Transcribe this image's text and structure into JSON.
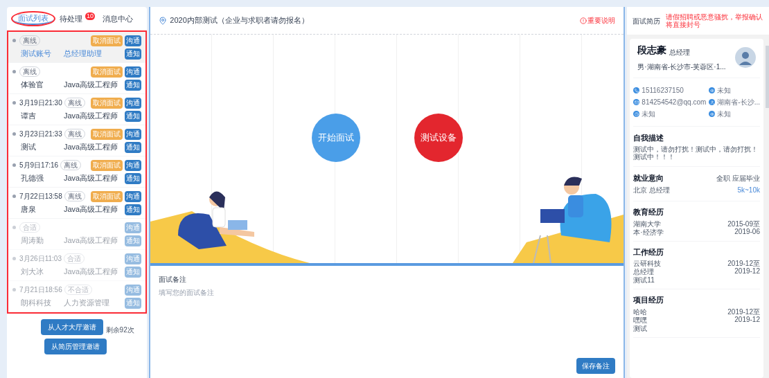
{
  "left": {
    "tabs": [
      {
        "label": "面试列表",
        "selected": true
      },
      {
        "label": "待处理",
        "badge": "10",
        "selected": false
      },
      {
        "label": "消息中心",
        "selected": false
      }
    ],
    "interviews": [
      {
        "status": "离线",
        "cancel": "取消面试",
        "chat": "沟通",
        "notify": "通知",
        "name": "测试账号",
        "position": "总经理助理",
        "selected": true,
        "faded": false
      },
      {
        "status": "离线",
        "cancel": "取消面试",
        "chat": "沟通",
        "notify": "通知",
        "name": "体验官",
        "position": "Java高级工程师",
        "selected": false,
        "faded": false
      },
      {
        "time": "3月19日21:30",
        "status": "离线",
        "cancel": "取消面试",
        "chat": "沟通",
        "notify": "通知",
        "name": "谭吉",
        "position": "Java高级工程师",
        "selected": false,
        "faded": false
      },
      {
        "time": "3月23日21:33",
        "status": "离线",
        "cancel": "取消面试",
        "chat": "沟通",
        "notify": "通知",
        "name": "测试",
        "position": "Java高级工程师",
        "selected": false,
        "faded": false
      },
      {
        "time": "5月9日17:16",
        "status": "离线",
        "cancel": "取消面试",
        "chat": "沟通",
        "notify": "通知",
        "name": "孔德强",
        "position": "Java高级工程师",
        "selected": false,
        "faded": false
      },
      {
        "time": "7月22日13:58",
        "status": "离线",
        "cancel": "取消面试",
        "chat": "沟通",
        "notify": "通知",
        "name": "唐泉",
        "position": "Java高级工程师",
        "selected": false,
        "faded": false
      },
      {
        "status": "合适",
        "chat": "沟通",
        "notify": "通知",
        "name": "周涛勤",
        "position": "Java高级工程师",
        "selected": false,
        "faded": true
      },
      {
        "time": "3月26日11:03",
        "status": "合适",
        "chat": "沟通",
        "notify": "通知",
        "name": "刘大冰",
        "position": "Java高级工程师",
        "selected": false,
        "faded": true
      },
      {
        "time": "7月21日18:56",
        "status": "不合适",
        "chat": "沟通",
        "notify": "通知",
        "name": "朗科科技",
        "position": "人力资源管理",
        "selected": false,
        "faded": true
      }
    ],
    "invite_hall": "从人才大厅邀请",
    "remaining": "剩余92次",
    "invite_resume": "从简历管理邀请"
  },
  "center": {
    "title": "2020内部测试（企业与求职者请勿报名）",
    "notice": "重要说明",
    "actions": [
      {
        "label": "开始面试",
        "kind": "start"
      },
      {
        "label": "测试设备",
        "kind": "test"
      }
    ],
    "notes_label": "面试备注",
    "notes_placeholder": "填写您的面试备注",
    "save": "保存备注"
  },
  "right": {
    "title": "面试简历",
    "warning": "请假招聘或恶意骚扰，举报确认将直接封号",
    "name": "段志豪",
    "role": "总经理",
    "summary": "男·湖南省-长沙市-芙蓉区·1...",
    "contacts": [
      {
        "kind": "phone",
        "text": "15116237150"
      },
      {
        "kind": "eye",
        "text": "未知"
      },
      {
        "kind": "mail",
        "text": "814254542@qq.com"
      },
      {
        "kind": "user",
        "text": "湖南省-长沙..."
      },
      {
        "kind": "clock",
        "text": "未知"
      },
      {
        "kind": "eye",
        "text": "未知"
      }
    ],
    "self_title": "自我描述",
    "self_text": "测试中，请勿打扰！测试中，请勿打扰！测试中！！！",
    "intent_title": "就业意向",
    "intent_type": "全职 应届毕业",
    "intent_place": "北京 总经理",
    "intent_salary": "5k~10k",
    "sections": [
      {
        "title": "教育经历",
        "lines": [
          "湖南大学",
          "本·经济学"
        ],
        "start": "2015-09至",
        "end": "2019-06"
      },
      {
        "title": "工作经历",
        "lines": [
          "云研科技",
          "总经理",
          "测试11"
        ],
        "start": "2019-12至",
        "end": "2019-12"
      },
      {
        "title": "项目经历",
        "lines": [
          "哈哈",
          "嘿嘿",
          "测试"
        ],
        "start": "2019-12至",
        "end": "2019-12"
      }
    ]
  }
}
